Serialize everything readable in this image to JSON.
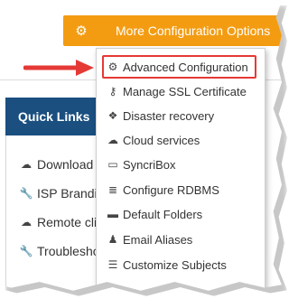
{
  "top_button": {
    "label": "More Configuration Options",
    "icon": "gears-icon"
  },
  "quick_links": {
    "title": "Quick Links",
    "items": [
      {
        "label": "Download",
        "icon": "cloud-download-icon"
      },
      {
        "label": "ISP Brandin",
        "icon": "wrench-icon"
      },
      {
        "label": "Remote cli",
        "icon": "cloud-icon"
      },
      {
        "label": "Troublesho",
        "icon": "wrench-icon"
      }
    ]
  },
  "dropdown": {
    "items": [
      {
        "label": "Advanced Configuration",
        "icon": "gear-icon"
      },
      {
        "label": "Manage SSL Certificate",
        "icon": "key-icon"
      },
      {
        "label": "Disaster recovery",
        "icon": "cubes-icon"
      },
      {
        "label": "Cloud services",
        "icon": "cloud-icon"
      },
      {
        "label": "SyncriBox",
        "icon": "hdd-icon"
      },
      {
        "label": "Configure RDBMS",
        "icon": "database-icon"
      },
      {
        "label": "Default Folders",
        "icon": "folder-icon"
      },
      {
        "label": "Email Aliases",
        "icon": "user-icon"
      },
      {
        "label": "Customize Subjects",
        "icon": "list-icon"
      }
    ]
  },
  "colors": {
    "accent": "#f39c12",
    "header": "#1a4f80",
    "highlight": "#e53935"
  }
}
